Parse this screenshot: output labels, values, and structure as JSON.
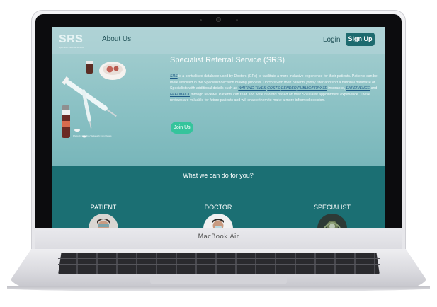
{
  "device": {
    "model_label": "MacBook Air"
  },
  "navbar": {
    "logo": "SRS",
    "logo_subtitle": "Specialist Referral Service",
    "about_label": "About Us",
    "login_label": "Login",
    "signup_label": "Sign Up"
  },
  "hero": {
    "photo_credit": "Photo by Nataliya Vaitkevich from Pexels",
    "title": "Specialist Referral Service (SRS)",
    "body": {
      "p1": "SRS",
      "p2": " is a centralised database used by Doctors (GPs) to facilitate a more inclusive experience for their patients. Patients can be more involved in the Specialist decision making process. Doctors with their patients jointly filter and sort a national database of Specialists with additional details such as ",
      "waiting": "WAITING TIMES",
      "costs": "COSTS",
      "gender": "GENDER",
      "public_private": "PUBLIC/PRIVATE",
      "p3": " insurance, ",
      "experience": "EXPERIENCE",
      "p4": " and ",
      "feedback": "FEEDBACK",
      "p5": " through reviews. Patients can read and write reviews based on their Specialist appointment experience. These reviews are valuable for future patients and will enable them to make a more informed decision."
    },
    "join_label": "Join Us"
  },
  "section": {
    "title": "What we can do for you?",
    "roles": [
      "PATIENT",
      "DOCTOR",
      "SPECIALIST"
    ]
  },
  "colors": {
    "teal_dark": "#1b6f73",
    "accent_green": "#35c49c",
    "signup_bg": "#1e6b6f"
  }
}
